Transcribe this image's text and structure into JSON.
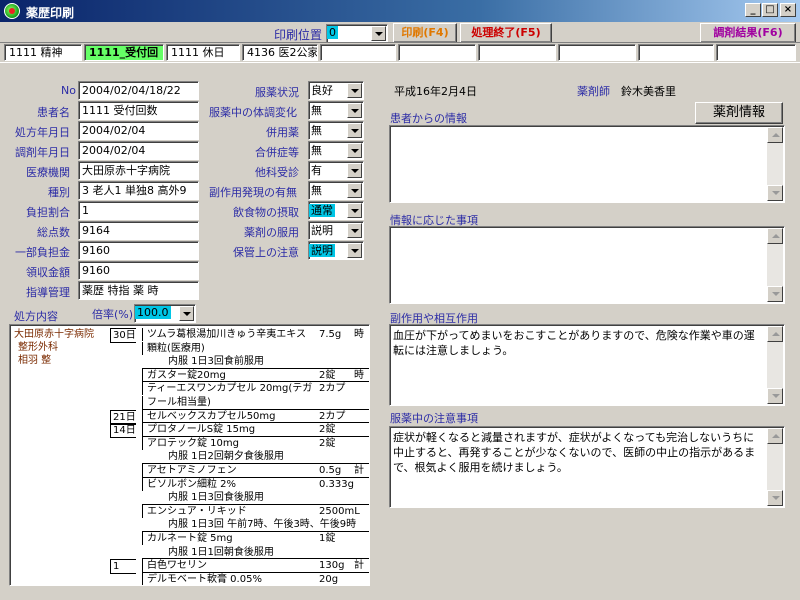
{
  "window": {
    "title": "薬歴印刷",
    "minimize": "_",
    "maximize": "□",
    "close": "×"
  },
  "toolbar": {
    "print_position_label": "印刷位置",
    "print_position_value": "0",
    "print_button": "印刷(F4)",
    "finish_button": "処理終了(F5)",
    "result_button": "調剤結果(F6)"
  },
  "status_row": {
    "cells": [
      "1111 精神",
      "1111_受付回",
      "1111 休日",
      "4136 医2公家"
    ]
  },
  "patient_form": {
    "no_label": "No",
    "no_value": "2004/02/04/18/22",
    "name_label": "患者名",
    "name_value": "1111 受付回数",
    "rx_date_label": "処方年月日",
    "rx_date_value": "2004/02/04",
    "dispense_date_label": "調剤年月日",
    "dispense_date_value": "2004/02/04",
    "institution_label": "医療機関",
    "institution_value": "大田原赤十字病院",
    "type_label": "種別",
    "type_value": "3 老人1 単独8 高外9",
    "burden_ratio_label": "負担割合",
    "burden_ratio_value": "1",
    "total_points_label": "総点数",
    "total_points_value": "9164",
    "copay_label": "一部負担金",
    "copay_value": "9160",
    "received_label": "領収金額",
    "received_value": "9160",
    "guidance_label": "指導管理",
    "guidance_value": "薬歴 特指 薬 時"
  },
  "medication_status": {
    "status_label": "服薬状況",
    "status_value": "良好",
    "change_label": "服薬中の体調変化",
    "change_value": "無",
    "concomitant_label": "併用薬",
    "concomitant_value": "無",
    "complication_label": "合併症等",
    "complication_value": "無",
    "other_dept_label": "他科受診",
    "other_dept_value": "有",
    "side_effect_label": "副作用発現の有無",
    "side_effect_value": "無",
    "food_label": "飲食物の摂取",
    "food_value": "通常",
    "usage_label": "薬剤の服用",
    "usage_value": "説明",
    "storage_label": "保管上の注意",
    "storage_value": "説明"
  },
  "right_panel": {
    "date": "平成16年2月4日",
    "pharmacist_label": "薬剤師",
    "pharmacist_name": "鈴木美香里",
    "drug_info_button": "薬剤情報",
    "patient_info_label": "患者からの情報",
    "patient_info_text": "",
    "response_label": "情報に応じた事項",
    "response_text": "",
    "side_effect_label": "副作用や相互作用",
    "side_effect_text": "血圧が下がってめまいをおこすことがありますので、危険な作業や車の運転には注意しましょう。",
    "caution_label": "服薬中の注意事項",
    "caution_text": "症状が軽くなると減量されますが、症状がよくなっても完治しないうちに中止すると、再発することが少なくないので、医師の中止の指示があるまで、根気よく服用を続けましょう。"
  },
  "rx_section": {
    "label": "処方内容",
    "magnification_label": "倍率(%)",
    "magnification_value": "100.0",
    "institution_lines": [
      "大田原赤十字病院",
      "整形外科",
      "相羽 整"
    ],
    "rows": [
      {
        "days": "30日",
        "drug": "ツムラ葛根湯加川きゅう辛夷エキス",
        "qty": "7.5g",
        "tail": "時"
      },
      {
        "days": "",
        "drug": "顆粒(医療用)",
        "qty": "",
        "tail": ""
      },
      {
        "days": "",
        "use": "内服 1日3回食前服用"
      },
      {
        "days": "",
        "drug": "ガスター錠20mg",
        "qty": "2錠",
        "tail": "時",
        "sep": true
      },
      {
        "days": "",
        "drug": "ティーエスワンカプセル 20mg(テガ",
        "qty": "2カプ",
        "tail": "",
        "sep": true
      },
      {
        "days": "",
        "drug": "フール相当量)",
        "qty": "",
        "tail": ""
      },
      {
        "days": "21日",
        "drug": "セルベックスカプセル50mg",
        "qty": "2カプ",
        "tail": "",
        "sep": true
      },
      {
        "days": "14日",
        "drug": "プロタノールS錠 15mg",
        "qty": "2錠",
        "tail": "",
        "sep": true
      },
      {
        "days": "",
        "drug": "アロテック錠 10mg",
        "qty": "2錠",
        "tail": "",
        "sep": true
      },
      {
        "days": "",
        "use": "内服 1日2回朝夕食後服用"
      },
      {
        "days": "",
        "drug": "アセトアミノフェン",
        "qty": "0.5g",
        "tail": "計",
        "sep": true
      },
      {
        "days": "",
        "drug": "ビソルボン細粒 2%",
        "qty": "0.333g",
        "tail": "",
        "sep": true
      },
      {
        "days": "",
        "use": "内服 1日3回食後服用"
      },
      {
        "days": "",
        "drug": "エンシュア・リキッド",
        "qty": "2500mL",
        "tail": "",
        "sep": true
      },
      {
        "days": "",
        "use": "内服 1日3回 午前7時、午後3時、午後9時"
      },
      {
        "days": "",
        "drug": "カルネート錠 5mg",
        "qty": "1錠",
        "tail": "",
        "sep": true
      },
      {
        "days": "",
        "use": "内服 1日1回朝食後服用"
      },
      {
        "days": "1",
        "drug": "白色ワセリン",
        "qty": "130g",
        "tail": "計",
        "sep": true
      },
      {
        "days": "",
        "drug": "デルモベート軟膏 0.05%",
        "qty": "20g",
        "tail": "",
        "sep": true
      }
    ]
  },
  "colors": {
    "label": "#2c2ca6",
    "print_button_text": "#e07800",
    "finish_button_text": "#cc0000",
    "result_button_text": "#a000a0",
    "status_highlight": "#66ff66",
    "combo_highlight": "#00c6e6"
  }
}
